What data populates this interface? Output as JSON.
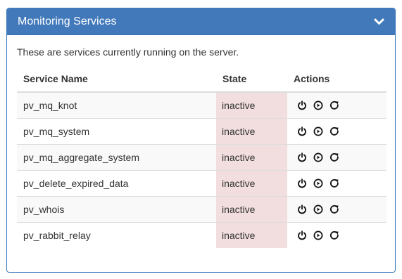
{
  "panel": {
    "title": "Monitoring Services",
    "collapse_icon": "chevron-down-icon",
    "intro": "These are services currently running on the server."
  },
  "table": {
    "columns": [
      "Service Name",
      "State",
      "Actions"
    ],
    "rows": [
      {
        "name": "pv_mq_knot",
        "state": "inactive"
      },
      {
        "name": "pv_mq_system",
        "state": "inactive"
      },
      {
        "name": "pv_mq_aggregate_system",
        "state": "inactive"
      },
      {
        "name": "pv_delete_expired_data",
        "state": "inactive"
      },
      {
        "name": "pv_whois",
        "state": "inactive"
      },
      {
        "name": "pv_rabbit_relay",
        "state": "inactive"
      }
    ],
    "action_icons": [
      "power-icon",
      "play-circle-icon",
      "restart-icon"
    ]
  },
  "colors": {
    "header_bg": "#4279bb",
    "inactive_bg": "#f2dede",
    "stripe_bg": "#f9f9f9"
  }
}
